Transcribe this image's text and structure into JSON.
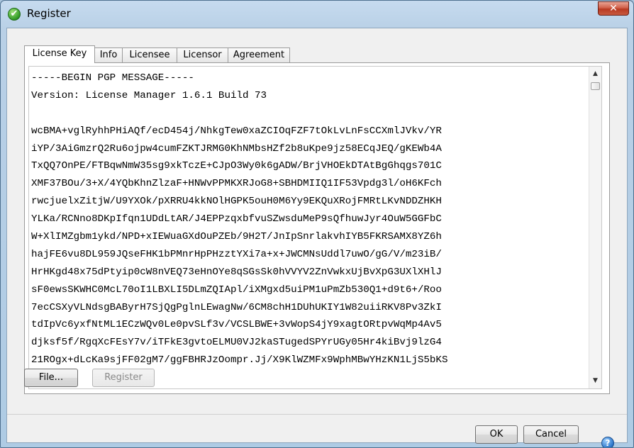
{
  "window": {
    "title": "Register",
    "title_icon": "✔",
    "close_glyph": "✕"
  },
  "tabs": [
    {
      "label": "License Key",
      "active": true
    },
    {
      "label": "Info",
      "active": false
    },
    {
      "label": "Licensee",
      "active": false
    },
    {
      "label": "Licensor",
      "active": false
    },
    {
      "label": "Agreement",
      "active": false
    }
  ],
  "license_text": {
    "lines": [
      "-----BEGIN PGP MESSAGE-----",
      "Version: License Manager 1.6.1 Build 73",
      "",
      "wcBMA+vglRyhhPHiAQf/ecD454j/NhkgTew0xaZCIOqFZF7tOkLvLnFsCCXmlJVkv/YR",
      "iYP/3AiGmzrQ2Ru6ojpw4cumFZKTJRMG0KhNMbsHZf2b8uKpe9jz58ECqJEQ/gKEWb4A",
      "TxQQ7OnPE/FTBqwNmW35sg9xkTczE+CJpO3Wy0k6gADW/BrjVHOEkDTAtBgGhqgs701C",
      "XMF37BOu/3+X/4YQbKhnZlzaF+HNWvPPMKXRJoG8+SBHDMIIQ1IF53Vpdg3l/oH6KFch",
      "rwcjuelxZitjW/U9YXOk/pXRRU4kkNOlHGPK5ouH0M6Yy9EKQuXRojFMRtLKvNDDZHKH",
      "YLKa/RCNno8DKpIfqn1UDdLtAR/J4EPPzqxbfvuSZwsduMeP9sQfhuwJyr4OuW5GGFbC",
      "W+XlIMZgbm1ykd/NPD+xIEWuaGXdOuPZEb/9H2T/JnIpSnrlakvhIYB5FKRSAMX8YZ6h",
      "hajFE6vu8DL959JQseFHK1bPMnrHpPHzztYXi7a+x+JWCMNsUddl7uwO/gG/V/m23iB/",
      "HrHKgd48x75dPtyip0cW8nVEQ73eHnOYe8qSGsSk0hVVYV2ZnVwkxUjBvXpG3UXlXHlJ",
      "sF0ewsSKWHC0McL70oI1LBXLI5DLmZQIApl/iXMgxd5uiPM1uPmZb530Q1+d9t6+/Roo",
      "7ecCSXyVLNdsgBAByrH7SjQgPglnLEwagNw/6CM8chH1DUhUKIY1W82uiiRKV8Pv3ZkI",
      "tdIpVc6yxfNtML1ECzWQv0Le0pvSLf3v/VCSLBWE+3vWopS4jY9xagtORtpvWqMp4Av5",
      "djksf5f/RgqXcFEsY7v/iTFkE3gvtoELMU0VJ2kaSTugedSPYrUGy05Hr4kiBvj9lzG4",
      "21ROgx+dLcKa9sjFF02gM7/ggFBHRJzOompr.Jj/X9KlWZMFx9WphMBwYHzKN1LjS5bKS"
    ]
  },
  "buttons": {
    "file": "File...",
    "register": "Register",
    "ok": "OK",
    "cancel": "Cancel"
  },
  "help_glyph": "?",
  "scroll_up_glyph": "▲",
  "scroll_down_glyph": "▼",
  "colors": {
    "title_bar": "#b9d0e6",
    "close_button": "#c85a40",
    "help_icon": "#2a74c8"
  }
}
